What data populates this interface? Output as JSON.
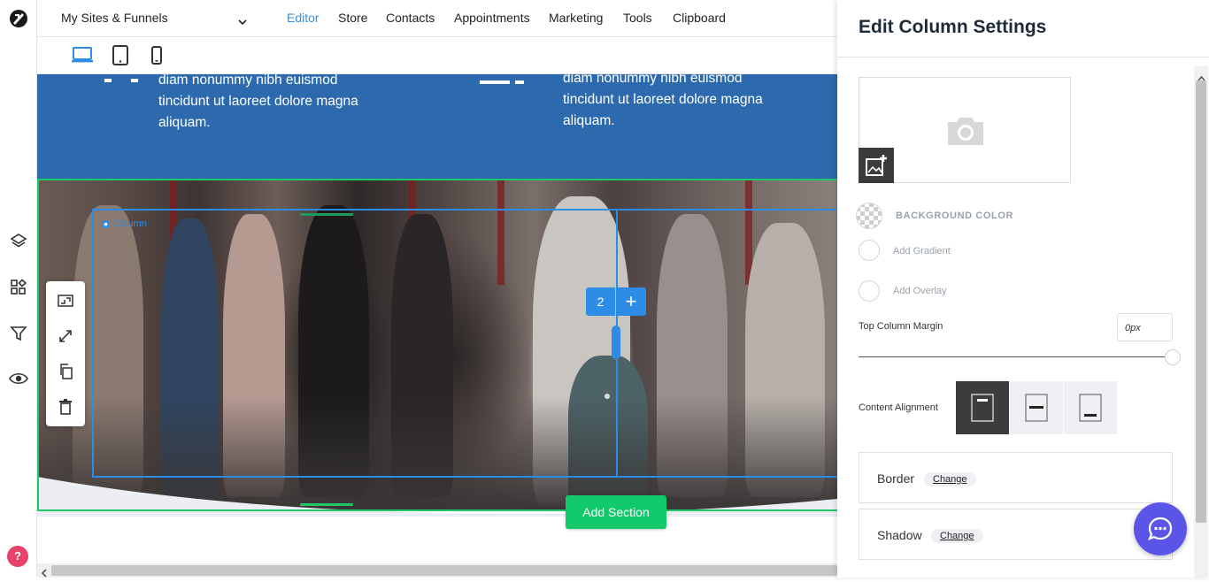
{
  "app": {
    "logo_icon": "brand-logo-icon"
  },
  "topnav": {
    "site_select": "My Sites & Funnels",
    "links": [
      "Editor",
      "Store",
      "Contacts",
      "Appointments",
      "Marketing",
      "Tools",
      "Clipboard"
    ],
    "active": "Editor",
    "active_color": "#3b8fd6"
  },
  "devices": [
    "desktop-icon",
    "tablet-icon",
    "mobile-icon"
  ],
  "rail_icons": [
    "layers-icon",
    "widgets-icon",
    "funnel-icon",
    "preview-eye-icon"
  ],
  "canvas": {
    "feature_left": "diam nonummy nibh euismod tincidunt ut laoreet dolore magna aliquam.",
    "feature_right": "diam nonummy nibh euismod tincidunt ut laoreet dolore magna aliquam.",
    "column_label": "Column",
    "column_count": "2",
    "add_section": "Add Section",
    "section_color": "#2c6aad",
    "add_section_color": "#12c96c",
    "selection_color": "#2d8ce6"
  },
  "toolbox": [
    "background-image-icon",
    "resize-icon",
    "duplicate-icon",
    "delete-icon"
  ],
  "panel": {
    "title": "Edit Column Settings",
    "bg_color_label": "BACKGROUND COLOR",
    "add_gradient": "Add Gradient",
    "add_overlay": "Add Overlay",
    "top_margin_label": "Top Column Margin",
    "top_margin_value": "0px",
    "content_alignment_label": "Content Alignment",
    "alignment_options": [
      "top",
      "middle",
      "bottom"
    ],
    "alignment_selected": "top",
    "border_label": "Border",
    "shadow_label": "Shadow",
    "change_label": "Change"
  },
  "help": "?"
}
